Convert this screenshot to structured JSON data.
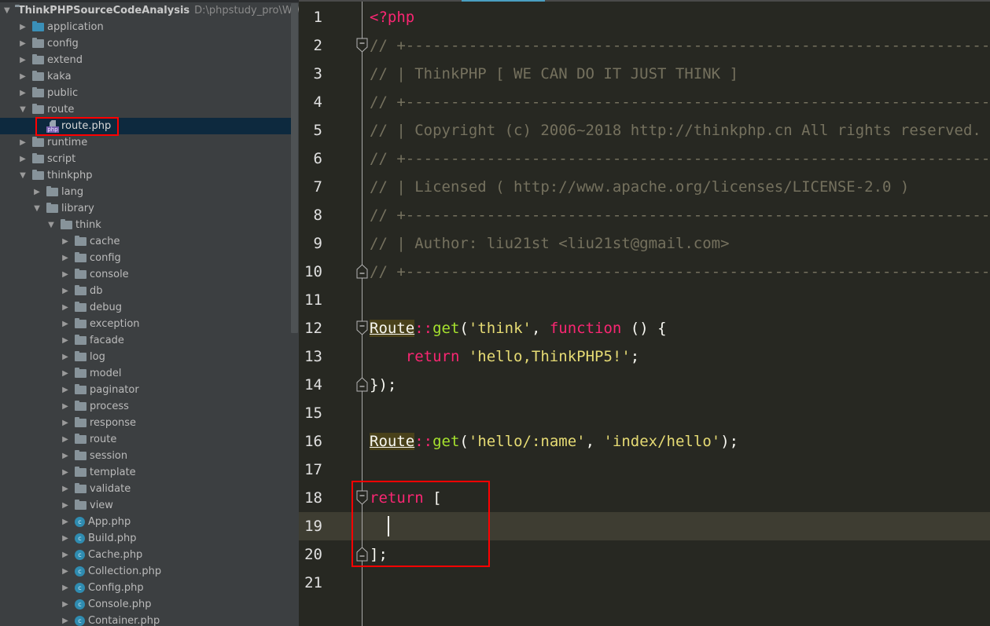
{
  "project_tree": {
    "root": {
      "label": "ThinkPHPSourceCodeAnalysis",
      "path": "D:\\phpstudy_pro\\WWW\\T"
    },
    "items": [
      {
        "label": "application",
        "type": "folder-blue",
        "depth": 1,
        "expanded": false
      },
      {
        "label": "config",
        "type": "folder",
        "depth": 1,
        "expanded": false
      },
      {
        "label": "extend",
        "type": "folder",
        "depth": 1,
        "expanded": false
      },
      {
        "label": "kaka",
        "type": "folder",
        "depth": 1,
        "expanded": false
      },
      {
        "label": "public",
        "type": "folder",
        "depth": 1,
        "expanded": false
      },
      {
        "label": "route",
        "type": "folder",
        "depth": 1,
        "expanded": true
      },
      {
        "label": "route.php",
        "type": "php-file",
        "depth": 2,
        "selected": true
      },
      {
        "label": "runtime",
        "type": "folder",
        "depth": 1,
        "expanded": false
      },
      {
        "label": "script",
        "type": "folder",
        "depth": 1,
        "expanded": false
      },
      {
        "label": "thinkphp",
        "type": "folder",
        "depth": 1,
        "expanded": true
      },
      {
        "label": "lang",
        "type": "folder",
        "depth": 2,
        "expanded": false
      },
      {
        "label": "library",
        "type": "folder",
        "depth": 2,
        "expanded": true
      },
      {
        "label": "think",
        "type": "folder",
        "depth": 3,
        "expanded": true
      },
      {
        "label": "cache",
        "type": "folder",
        "depth": 4,
        "expanded": false
      },
      {
        "label": "config",
        "type": "folder",
        "depth": 4,
        "expanded": false
      },
      {
        "label": "console",
        "type": "folder",
        "depth": 4,
        "expanded": false
      },
      {
        "label": "db",
        "type": "folder",
        "depth": 4,
        "expanded": false
      },
      {
        "label": "debug",
        "type": "folder",
        "depth": 4,
        "expanded": false
      },
      {
        "label": "exception",
        "type": "folder",
        "depth": 4,
        "expanded": false
      },
      {
        "label": "facade",
        "type": "folder",
        "depth": 4,
        "expanded": false
      },
      {
        "label": "log",
        "type": "folder",
        "depth": 4,
        "expanded": false
      },
      {
        "label": "model",
        "type": "folder",
        "depth": 4,
        "expanded": false
      },
      {
        "label": "paginator",
        "type": "folder",
        "depth": 4,
        "expanded": false
      },
      {
        "label": "process",
        "type": "folder",
        "depth": 4,
        "expanded": false
      },
      {
        "label": "response",
        "type": "folder",
        "depth": 4,
        "expanded": false
      },
      {
        "label": "route",
        "type": "folder",
        "depth": 4,
        "expanded": false
      },
      {
        "label": "session",
        "type": "folder",
        "depth": 4,
        "expanded": false
      },
      {
        "label": "template",
        "type": "folder",
        "depth": 4,
        "expanded": false
      },
      {
        "label": "validate",
        "type": "folder",
        "depth": 4,
        "expanded": false
      },
      {
        "label": "view",
        "type": "folder",
        "depth": 4,
        "expanded": false
      },
      {
        "label": "App.php",
        "type": "class",
        "depth": 4,
        "expanded": false
      },
      {
        "label": "Build.php",
        "type": "class",
        "depth": 4,
        "expanded": false
      },
      {
        "label": "Cache.php",
        "type": "class",
        "depth": 4,
        "expanded": false
      },
      {
        "label": "Collection.php",
        "type": "class",
        "depth": 4,
        "expanded": false
      },
      {
        "label": "Config.php",
        "type": "class",
        "depth": 4,
        "expanded": false
      },
      {
        "label": "Console.php",
        "type": "class",
        "depth": 4,
        "expanded": false
      },
      {
        "label": "Container.php",
        "type": "class",
        "depth": 4,
        "expanded": false
      }
    ],
    "icons": {
      "php_badge": "php",
      "class_badge": "c",
      "expanded": "▼",
      "collapsed": "▶"
    }
  },
  "editor": {
    "file": "route.php",
    "current_line": 19,
    "lines": [
      {
        "n": "1",
        "fold": "",
        "tokens": [
          {
            "t": "<?php",
            "c": "kw"
          }
        ]
      },
      {
        "n": "2",
        "fold": "open",
        "tokens": [
          {
            "t": "// +----------------------------------------------------------------------",
            "c": "comment"
          }
        ]
      },
      {
        "n": "3",
        "fold": "",
        "tokens": [
          {
            "t": "// | ThinkPHP [ WE CAN DO IT JUST THINK ]",
            "c": "comment"
          }
        ]
      },
      {
        "n": "4",
        "fold": "",
        "tokens": [
          {
            "t": "// +----------------------------------------------------------------------",
            "c": "comment"
          }
        ]
      },
      {
        "n": "5",
        "fold": "",
        "tokens": [
          {
            "t": "// | Copyright (c) 2006~2018 http://thinkphp.cn All rights reserved.",
            "c": "comment"
          }
        ]
      },
      {
        "n": "6",
        "fold": "",
        "tokens": [
          {
            "t": "// +----------------------------------------------------------------------",
            "c": "comment"
          }
        ]
      },
      {
        "n": "7",
        "fold": "",
        "tokens": [
          {
            "t": "// | Licensed ( http://www.apache.org/licenses/LICENSE-2.0 )",
            "c": "comment"
          }
        ]
      },
      {
        "n": "8",
        "fold": "",
        "tokens": [
          {
            "t": "// +----------------------------------------------------------------------",
            "c": "comment"
          }
        ]
      },
      {
        "n": "9",
        "fold": "",
        "tokens": [
          {
            "t": "// | Author: liu21st <liu21st@gmail.com>",
            "c": "comment"
          }
        ]
      },
      {
        "n": "10",
        "fold": "close",
        "tokens": [
          {
            "t": "// +----------------------------------------------------------------------",
            "c": "comment"
          }
        ]
      },
      {
        "n": "11",
        "fold": "",
        "tokens": []
      },
      {
        "n": "12",
        "fold": "open",
        "tokens": [
          {
            "t": "Route",
            "c": "class"
          },
          {
            "t": "::",
            "c": "op"
          },
          {
            "t": "get",
            "c": "fn"
          },
          {
            "t": "(",
            "c": "plain"
          },
          {
            "t": "'think'",
            "c": "str"
          },
          {
            "t": ", ",
            "c": "plain"
          },
          {
            "t": "function",
            "c": "kw"
          },
          {
            "t": " () {",
            "c": "plain"
          }
        ]
      },
      {
        "n": "13",
        "fold": "",
        "tokens": [
          {
            "t": "    ",
            "c": "plain"
          },
          {
            "t": "return",
            "c": "kw"
          },
          {
            "t": " ",
            "c": "plain"
          },
          {
            "t": "'hello,ThinkPHP5!'",
            "c": "str"
          },
          {
            "t": ";",
            "c": "plain"
          }
        ]
      },
      {
        "n": "14",
        "fold": "close",
        "tokens": [
          {
            "t": "});",
            "c": "plain"
          }
        ]
      },
      {
        "n": "15",
        "fold": "",
        "tokens": []
      },
      {
        "n": "16",
        "fold": "",
        "tokens": [
          {
            "t": "Route",
            "c": "class"
          },
          {
            "t": "::",
            "c": "op"
          },
          {
            "t": "get",
            "c": "fn"
          },
          {
            "t": "(",
            "c": "plain"
          },
          {
            "t": "'hello/:name'",
            "c": "str"
          },
          {
            "t": ", ",
            "c": "plain"
          },
          {
            "t": "'index/hello'",
            "c": "str"
          },
          {
            "t": ");",
            "c": "plain"
          }
        ]
      },
      {
        "n": "17",
        "fold": "",
        "tokens": []
      },
      {
        "n": "18",
        "fold": "open",
        "tokens": [
          {
            "t": "return",
            "c": "kw"
          },
          {
            "t": " [",
            "c": "plain"
          }
        ]
      },
      {
        "n": "19",
        "fold": "",
        "tokens": [
          {
            "t": "  ",
            "c": "plain"
          }
        ],
        "caret": true
      },
      {
        "n": "20",
        "fold": "close",
        "tokens": [
          {
            "t": "];",
            "c": "plain"
          }
        ]
      },
      {
        "n": "21",
        "fold": "",
        "tokens": []
      }
    ]
  },
  "colors": {
    "annotation_red": "#ff0000",
    "selection_bg": "#0d293e",
    "active_tab": "#4a9fc1"
  }
}
